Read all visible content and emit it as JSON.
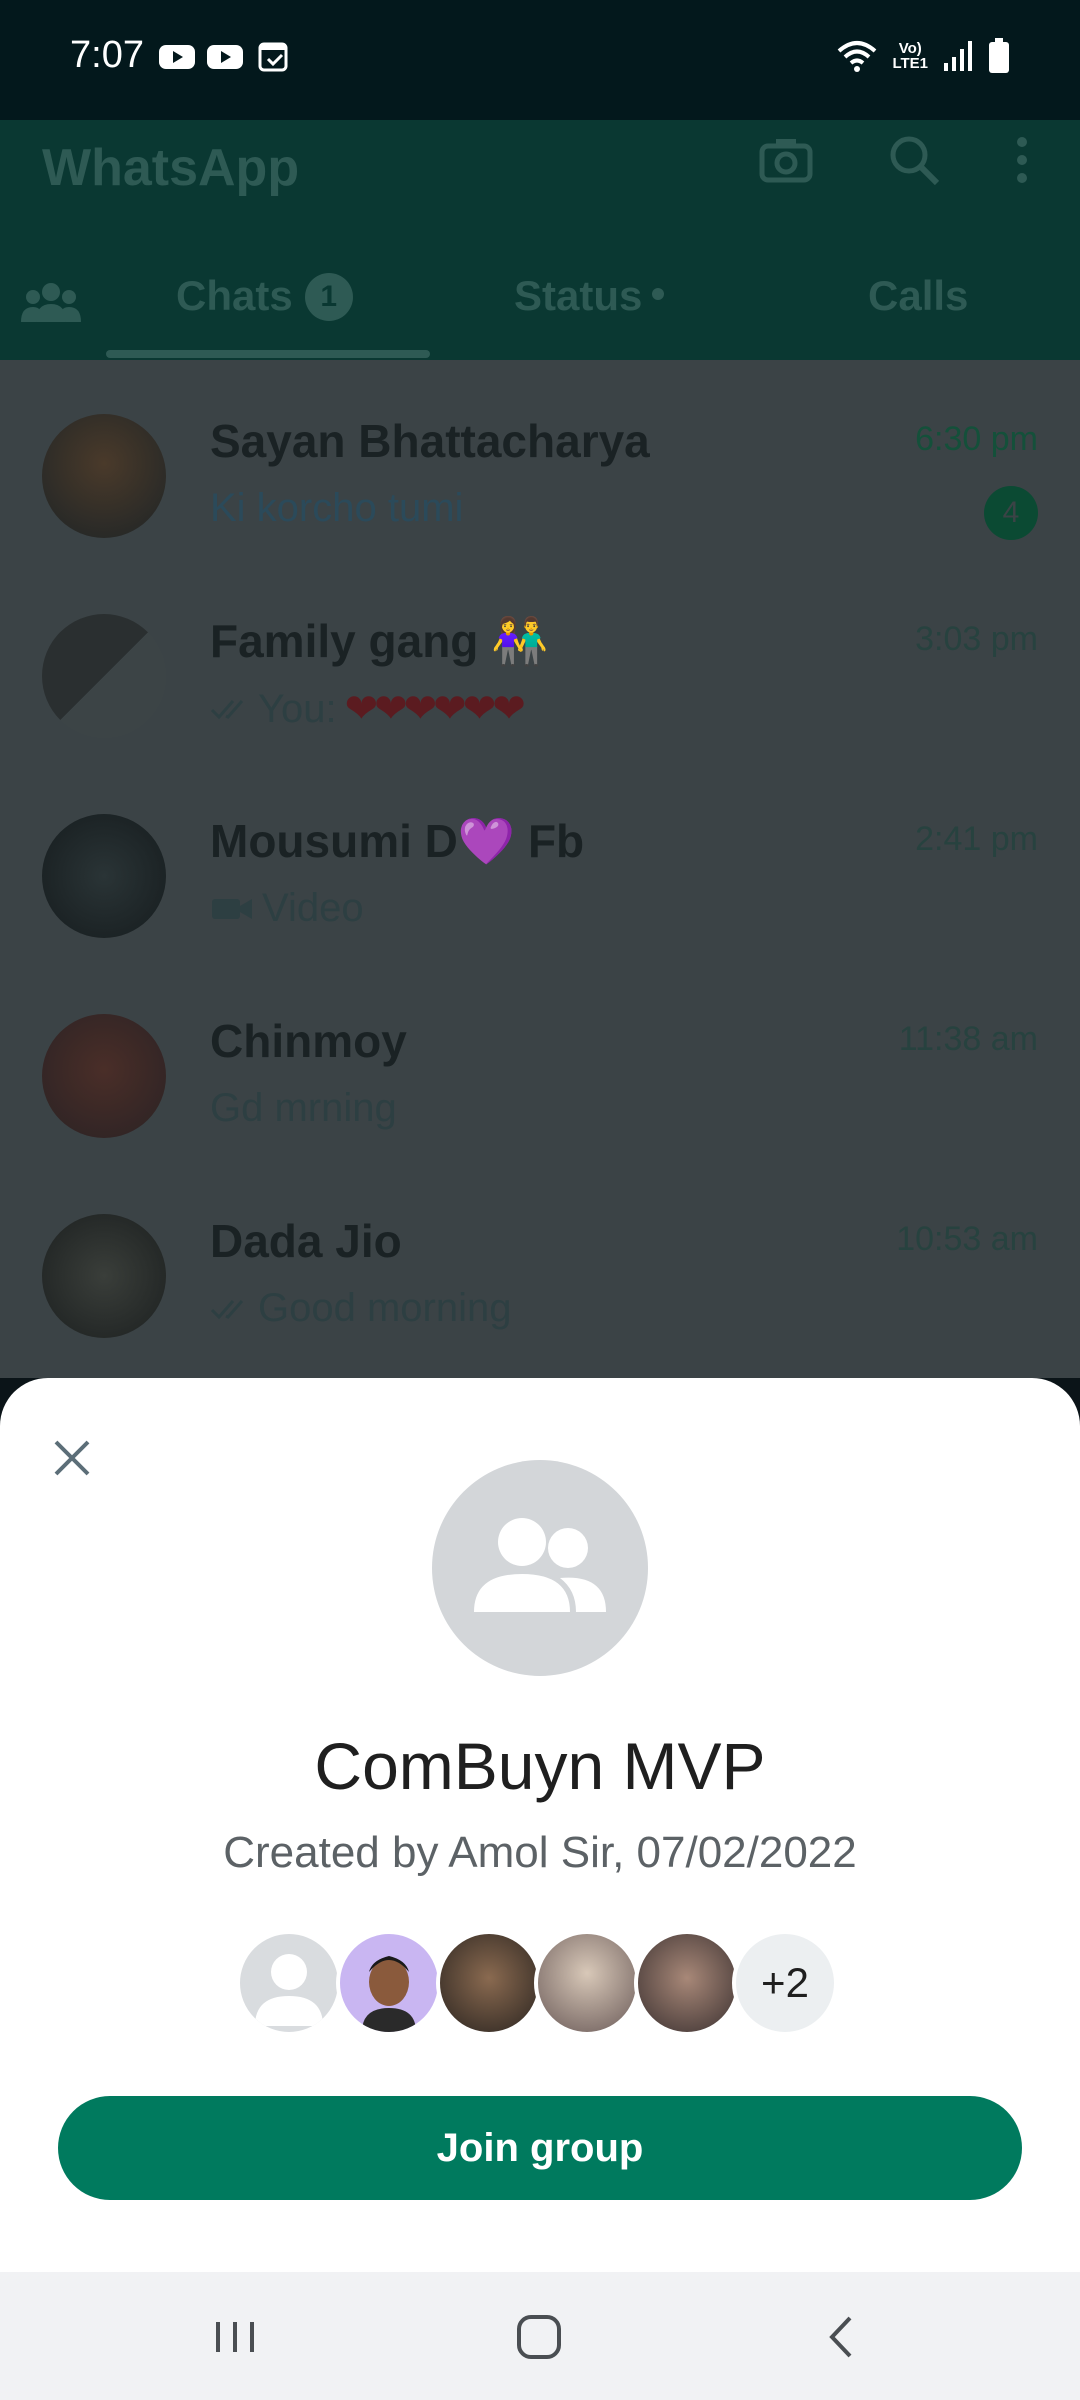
{
  "status_bar": {
    "time": "7:07",
    "network_label_top": "Vo)",
    "network_label_bottom": "LTE1",
    "icons": [
      "youtube-icon",
      "youtube-icon",
      "calendar-check-icon",
      "wifi-icon",
      "signal-icon",
      "battery-icon"
    ]
  },
  "app_bar": {
    "title": "WhatsApp",
    "icons": [
      "camera-icon",
      "search-icon",
      "more-vert-icon"
    ]
  },
  "tabs": [
    {
      "label": "Chats",
      "badge": "1"
    },
    {
      "label": "Status"
    },
    {
      "label": "Calls"
    }
  ],
  "chats": [
    {
      "name": "Sayan Bhattacharya",
      "message": "Ki korcho tumi",
      "time": "6:30 pm",
      "unread": "4"
    },
    {
      "name": "Family gang",
      "name_emoji": "👫",
      "message_prefix": "You: ",
      "message": "❤❤❤❤❤❤",
      "time": "3:03 pm"
    },
    {
      "name": "Mousumi D",
      "name_emoji": "💜",
      "name_suffix": " Fb",
      "message": "Video",
      "time": "2:41 pm"
    },
    {
      "name": "Chinmoy",
      "message": "Gd mrning",
      "time": "11:38 am"
    },
    {
      "name": "Dada Jio",
      "message": "Good morning",
      "time": "10:53 am"
    }
  ],
  "sheet": {
    "group_name": "ComBuyn MVP",
    "created_by": "Created by Amol Sir, 07/02/2022",
    "more_members": "+2",
    "join_label": "Join group"
  },
  "colors": {
    "accent": "#007a5e",
    "header_dim": "#0a3832",
    "sheet_bg": "#ffffff"
  }
}
